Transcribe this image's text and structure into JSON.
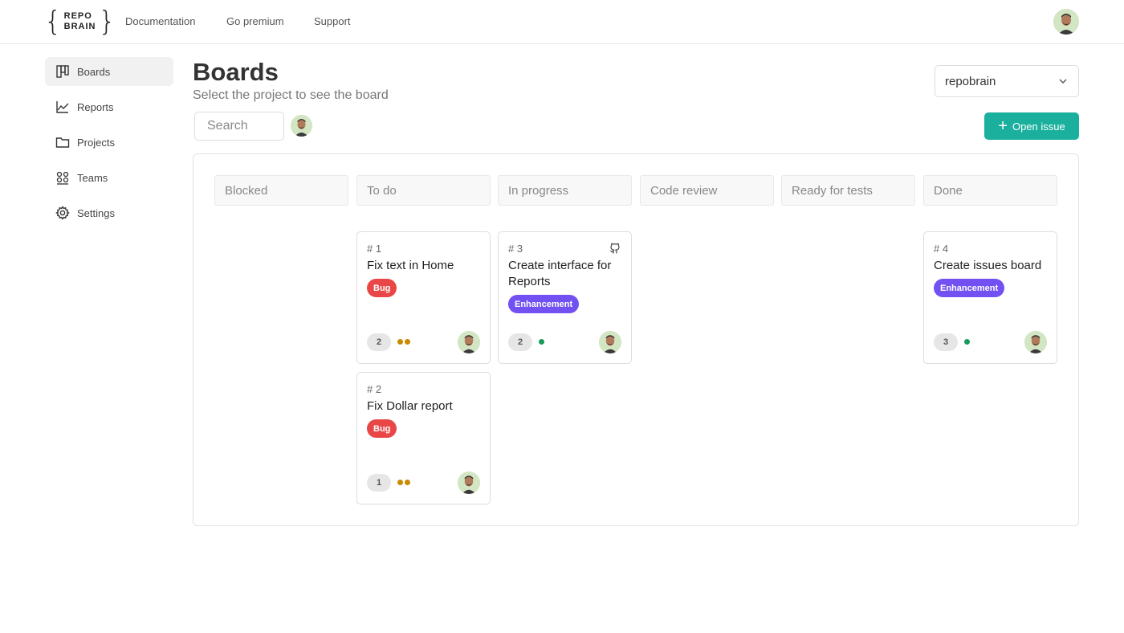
{
  "brand": {
    "line1": "REPO",
    "line2": "BRAIN",
    "open_brace": "{",
    "close_brace": "}"
  },
  "topnav": [
    "Documentation",
    "Go premium",
    "Support"
  ],
  "sidebar": {
    "items": [
      {
        "label": "Boards",
        "icon": "board-icon"
      },
      {
        "label": "Reports",
        "icon": "chart-icon"
      },
      {
        "label": "Projects",
        "icon": "folder-icon"
      },
      {
        "label": "Teams",
        "icon": "team-icon"
      },
      {
        "label": "Settings",
        "icon": "gear-icon"
      }
    ]
  },
  "page": {
    "title": "Boards",
    "subtitle": "Select the project to see the board",
    "project_selected": "repobrain",
    "search_placeholder": "Search",
    "open_issue_label": "Open issue"
  },
  "columns": [
    "Blocked",
    "To do",
    "In progress",
    "Code review",
    "Ready for tests",
    "Done"
  ],
  "cards": [
    {
      "number": "# 1",
      "title": "Fix text in Home",
      "tag": "Bug",
      "count": "2",
      "dots": [
        "#c98a00",
        "#c98a00"
      ]
    },
    {
      "number": "# 2",
      "title": "Fix Dollar report",
      "tag": "Bug",
      "count": "1",
      "dots": [
        "#c98a00",
        "#c98a00"
      ]
    },
    {
      "number": "# 3",
      "title": "Create interface for Reports",
      "tag": "Enhancement",
      "count": "2",
      "dots": [
        "#1a9a5a"
      ],
      "github": true
    },
    {
      "number": "# 4",
      "title": "Create issues board",
      "tag": "Enhancement",
      "count": "3",
      "dots": [
        "#1a9a5a"
      ]
    }
  ],
  "colors": {
    "accent": "#1bb09e",
    "bug": "#e94747",
    "enhancement": "#7250f2",
    "priority_medium": "#c98a00",
    "priority_low": "#1a9a5a"
  }
}
